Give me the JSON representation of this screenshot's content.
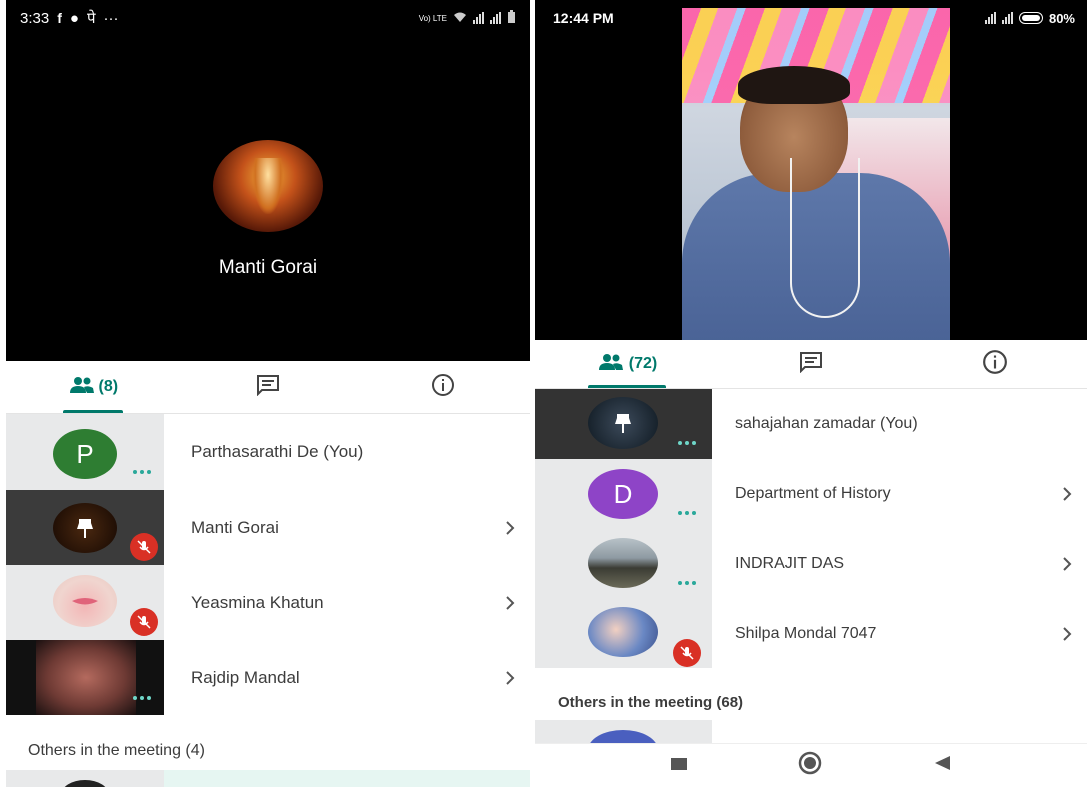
{
  "left": {
    "status": {
      "time": "3:33",
      "app_glyph": "पे",
      "more": "···",
      "carrier": "Vo) LTE"
    },
    "main_speaker": {
      "name": "Manti Gorai"
    },
    "tabs": {
      "people_count": "(8)"
    },
    "participants": [
      {
        "name": "Parthasarathi De (You)",
        "initial": "P",
        "avatar_color": "#2e7d32"
      },
      {
        "name": "Manti Gorai"
      },
      {
        "name": "Yeasmina Khatun"
      },
      {
        "name": "Rajdip Mandal"
      }
    ],
    "others_label": "Others in the meeting (4)"
  },
  "right": {
    "status": {
      "time": "12:44 PM",
      "battery": "80%"
    },
    "tabs": {
      "people_count": "(72)"
    },
    "participants": [
      {
        "name": "sahajahan zamadar (You)"
      },
      {
        "name": "Department of History",
        "initial": "D",
        "avatar_color": "#8e44c7"
      },
      {
        "name": "INDRAJIT DAS"
      },
      {
        "name": "Shilpa Mondal 7047"
      }
    ],
    "others_label": "Others in the meeting (68)"
  },
  "colors": {
    "accent": "#00796b",
    "dots": "#2aa89a",
    "mute": "#d93025"
  }
}
